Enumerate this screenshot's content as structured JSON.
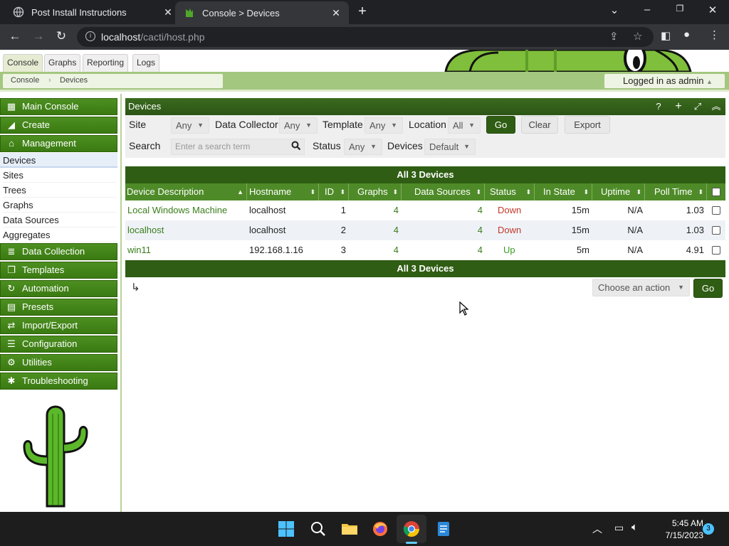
{
  "browser": {
    "tabs": [
      {
        "title": "Post Install Instructions"
      },
      {
        "title": "Console > Devices"
      }
    ],
    "url": {
      "host": "localhost",
      "path": "/cacti/host.php"
    }
  },
  "cacti": {
    "top_tabs": [
      "Console",
      "Graphs",
      "Reporting",
      "Logs"
    ],
    "breadcrumbs": [
      "Console",
      "Devices"
    ],
    "login_text": "Logged in as admin",
    "sidebar": {
      "main_console": "Main Console",
      "create": "Create",
      "management": "Management",
      "management_items": [
        "Devices",
        "Sites",
        "Trees",
        "Graphs",
        "Data Sources",
        "Aggregates"
      ],
      "data_collection": "Data Collection",
      "templates": "Templates",
      "automation": "Automation",
      "presets": "Presets",
      "import_export": "Import/Export",
      "configuration": "Configuration",
      "utilities": "Utilities",
      "troubleshooting": "Troubleshooting"
    },
    "panel_title": "Devices",
    "filters": {
      "site_label": "Site",
      "site_value": "Any",
      "collector_label": "Data Collector",
      "collector_value": "Any",
      "template_label": "Template",
      "template_value": "Any",
      "location_label": "Location",
      "location_value": "All",
      "go": "Go",
      "clear": "Clear",
      "export": "Export",
      "search_label": "Search",
      "search_placeholder": "Enter a search term",
      "status_label": "Status",
      "status_value": "Any",
      "devices_label": "Devices",
      "devices_value": "Default"
    },
    "count_text": "All 3 Devices",
    "columns": [
      "Device Description",
      "Hostname",
      "ID",
      "Graphs",
      "Data Sources",
      "Status",
      "In State",
      "Uptime",
      "Poll Time"
    ],
    "rows": [
      {
        "description": "Local Windows Machine",
        "hostname": "localhost",
        "id": "1",
        "graphs": "4",
        "data_sources": "4",
        "status": "Down",
        "in_state": "15m",
        "uptime": "N/A",
        "poll_time": "1.03"
      },
      {
        "description": "localhost",
        "hostname": "localhost",
        "id": "2",
        "graphs": "4",
        "data_sources": "4",
        "status": "Down",
        "in_state": "15m",
        "uptime": "N/A",
        "poll_time": "1.03"
      },
      {
        "description": "win11",
        "hostname": "192.168.1.16",
        "id": "3",
        "graphs": "4",
        "data_sources": "4",
        "status": "Up",
        "in_state": "5m",
        "uptime": "N/A",
        "poll_time": "4.91"
      }
    ],
    "action_select": "Choose an action",
    "action_go": "Go"
  },
  "taskbar": {
    "time": "5:45 AM",
    "date": "7/15/2023",
    "notification_count": "3"
  },
  "colors": {
    "accent_green": "#2f5d13",
    "header_green": "#4e8b28",
    "status_down": "#c0392b",
    "status_up": "#3a9d23"
  }
}
